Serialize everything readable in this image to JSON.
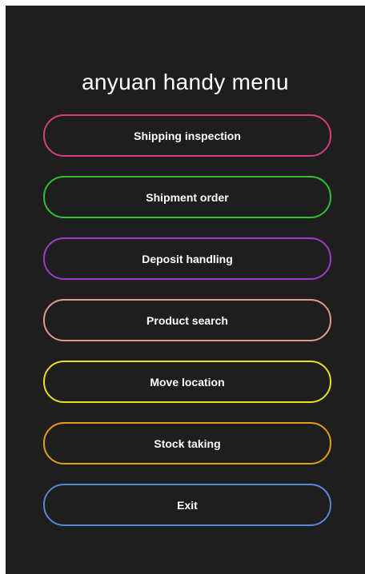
{
  "app": {
    "title": "anyuan handy menu"
  },
  "menu": {
    "items": [
      {
        "label": "Shipping inspection",
        "color": "#d63c84"
      },
      {
        "label": "Shipment order",
        "color": "#2ec22e"
      },
      {
        "label": "Deposit handling",
        "color": "#9b3cc8"
      },
      {
        "label": "Product search",
        "color": "#e09a88"
      },
      {
        "label": "Move location",
        "color": "#e8e020"
      },
      {
        "label": "Stock taking",
        "color": "#e89a18"
      },
      {
        "label": "Exit",
        "color": "#5a86d6"
      }
    ]
  },
  "colors": {
    "background": "#1e1e1e",
    "text": "#ffffff"
  }
}
